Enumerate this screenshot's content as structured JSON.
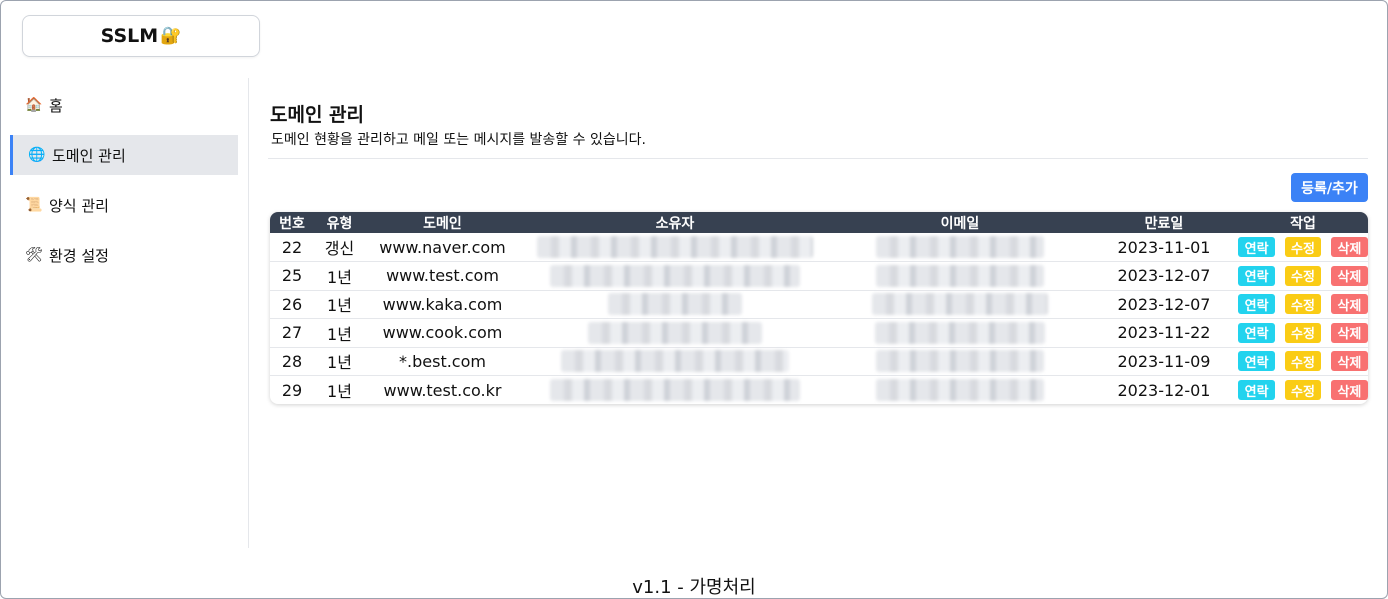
{
  "logo": {
    "text": "SSLM",
    "icon": "lock-icon",
    "icon_glyph": "🔐"
  },
  "sidebar": {
    "items": [
      {
        "label": "홈",
        "icon": "home-icon",
        "glyph": "🏠",
        "active": false
      },
      {
        "label": "도메인 관리",
        "icon": "globe-icon",
        "glyph": "🌐",
        "active": true
      },
      {
        "label": "양식 관리",
        "icon": "scroll-icon",
        "glyph": "📜",
        "active": false
      },
      {
        "label": "환경 설정",
        "icon": "tools-icon",
        "glyph": "🛠",
        "active": false
      }
    ]
  },
  "header": {
    "title": "도메인 관리",
    "subtitle": "도메인 현황을 관리하고 메일 또는 메시지를 발송할 수 있습니다."
  },
  "toolbar": {
    "add_label": "등록/추가"
  },
  "table": {
    "columns": [
      "번호",
      "유형",
      "도메인",
      "소유자",
      "이메일",
      "만료일",
      "작업"
    ],
    "rows": [
      {
        "no": "22",
        "type": "갱신",
        "domain": "www.naver.com",
        "expiry": "2023-11-01"
      },
      {
        "no": "25",
        "type": "1년",
        "domain": "www.test.com",
        "expiry": "2023-12-07"
      },
      {
        "no": "26",
        "type": "1년",
        "domain": "www.kaka.com",
        "expiry": "2023-12-07"
      },
      {
        "no": "27",
        "type": "1년",
        "domain": "www.cook.com",
        "expiry": "2023-11-22"
      },
      {
        "no": "28",
        "type": "1년",
        "domain": "*.best.com",
        "expiry": "2023-11-09"
      },
      {
        "no": "29",
        "type": "1년",
        "domain": "www.test.co.kr",
        "expiry": "2023-12-01"
      }
    ],
    "actions": {
      "contact": "연락",
      "edit": "수정",
      "delete": "삭제"
    }
  },
  "footer": {
    "text": "v1.1 - 가명처리"
  },
  "colors": {
    "accent": "#3b82f6",
    "header_bg": "#374151",
    "contact": "#22d3ee",
    "edit": "#facc15",
    "delete": "#f87171"
  }
}
